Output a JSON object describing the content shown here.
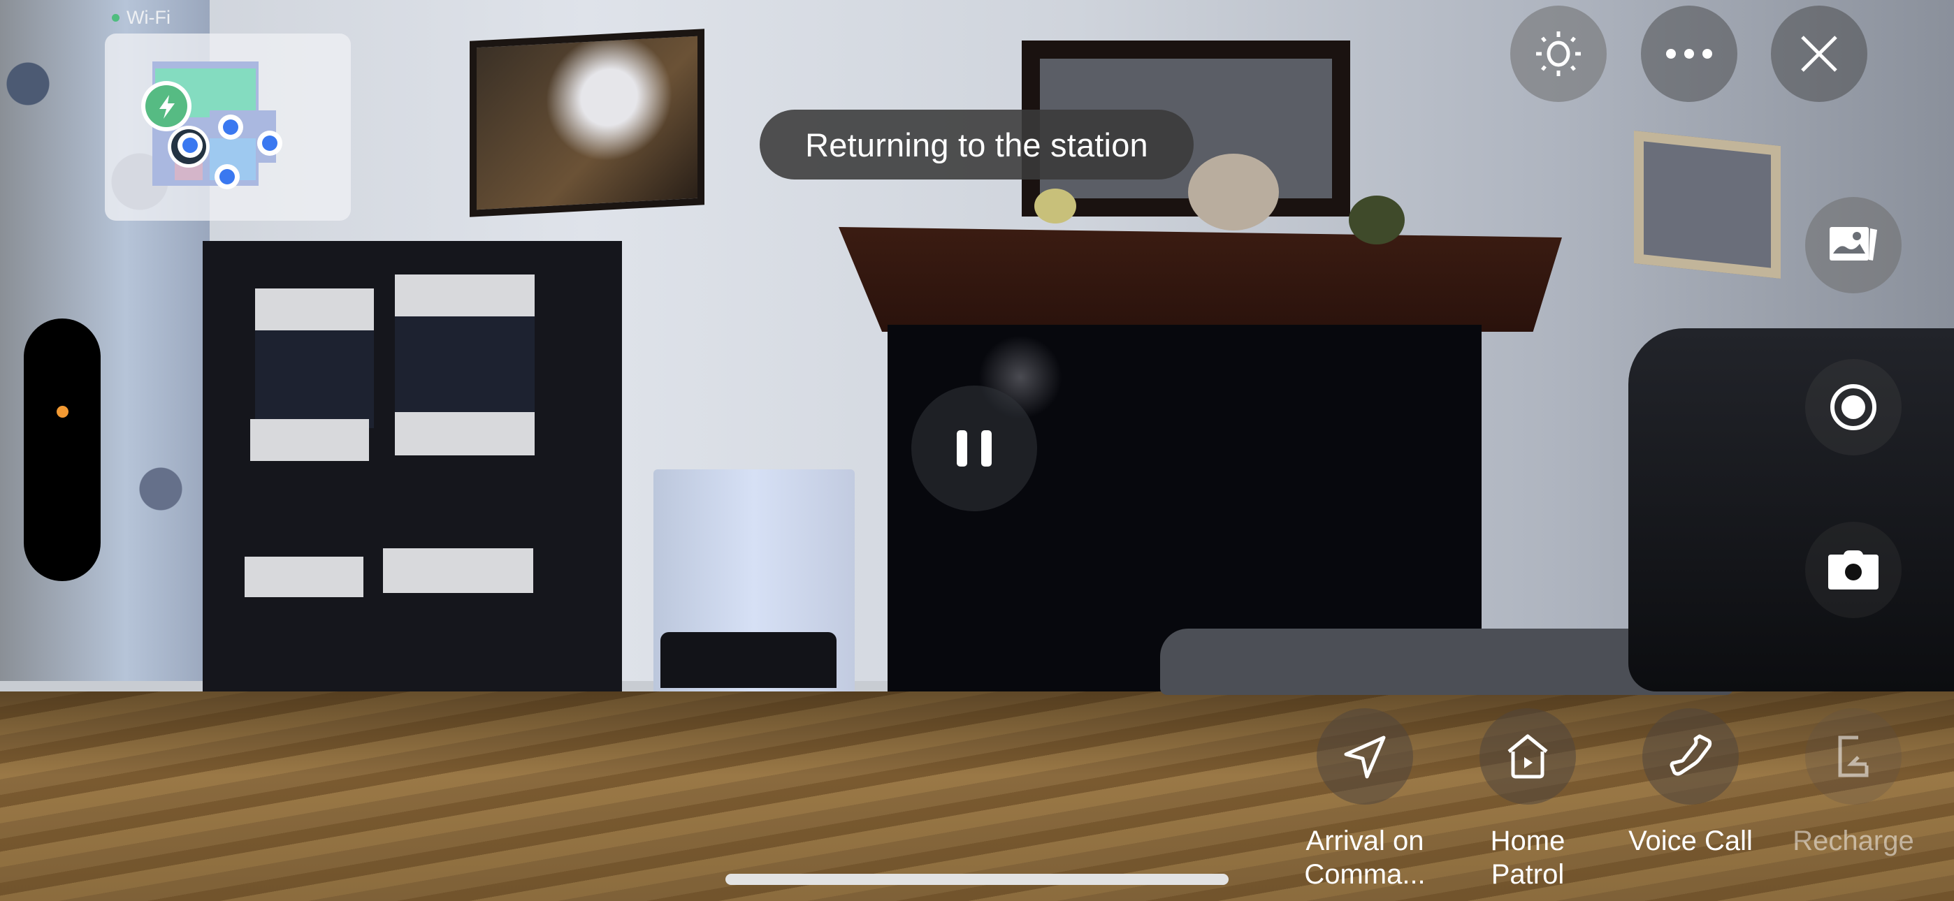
{
  "status_bar": {
    "connection_label": "Wi-Fi",
    "connection_color": "#4fbd7f"
  },
  "minimap": {
    "charging_icon": "lightning-bolt-icon",
    "robot_icon": "robot-position-icon",
    "waypoint_icon": "waypoint-dot-icon",
    "waypoint_count": 4,
    "dock_color": "#56bb83",
    "waypoint_color": "#3a78f0"
  },
  "top_controls": {
    "brightness_icon": "sun-brightness-icon",
    "more_icon": "more-dots-icon",
    "close_icon": "close-x-icon"
  },
  "status_toast": {
    "text": "Returning to the station"
  },
  "joystick": {
    "indicator_color": "#f39a33"
  },
  "playback": {
    "state": "playing",
    "control_icon": "pause-icon"
  },
  "side_controls": [
    {
      "name": "album",
      "icon": "photo-album-icon"
    },
    {
      "name": "record",
      "icon": "record-video-icon"
    },
    {
      "name": "snapshot",
      "icon": "camera-icon"
    }
  ],
  "actions": [
    {
      "label": "Arrival on\nComma...",
      "icon": "navigation-arrow-icon",
      "enabled": true
    },
    {
      "label": "Home\nPatrol",
      "icon": "home-patrol-icon",
      "enabled": true
    },
    {
      "label": "Voice Call",
      "icon": "phone-icon",
      "enabled": true
    },
    {
      "label": "Recharge",
      "icon": "recharge-dock-icon",
      "enabled": false
    }
  ]
}
